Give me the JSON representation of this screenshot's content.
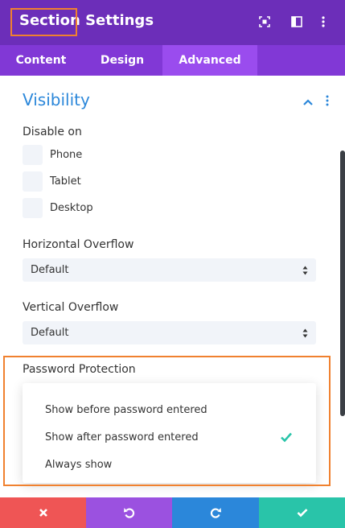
{
  "header": {
    "title": "Section Settings",
    "icons": [
      "screenshot-icon",
      "split-view-icon",
      "more-vertical-icon"
    ],
    "background_color": "#6c2eb9"
  },
  "tabs": [
    {
      "label": "Content",
      "active": false
    },
    {
      "label": "Design",
      "active": false
    },
    {
      "label": "Advanced",
      "active": true
    }
  ],
  "visibility": {
    "title": "Visibility",
    "disable_on": {
      "label": "Disable on",
      "options": [
        {
          "label": "Phone",
          "checked": false
        },
        {
          "label": "Tablet",
          "checked": false
        },
        {
          "label": "Desktop",
          "checked": false
        }
      ]
    },
    "horizontal_overflow": {
      "label": "Horizontal Overflow",
      "value": "Default"
    },
    "vertical_overflow": {
      "label": "Vertical Overflow",
      "value": "Default"
    },
    "password_protection": {
      "label": "Password Protection",
      "options": [
        {
          "label": "Show before password entered",
          "selected": false
        },
        {
          "label": "Show after password entered",
          "selected": true
        },
        {
          "label": "Always show",
          "selected": false
        }
      ]
    }
  },
  "footer": {
    "buttons": [
      {
        "name": "discard",
        "icon": "close-icon",
        "color": "#ef5555"
      },
      {
        "name": "undo",
        "icon": "undo-icon",
        "color": "#9b51e0"
      },
      {
        "name": "redo",
        "icon": "redo-icon",
        "color": "#2b87da"
      },
      {
        "name": "save",
        "icon": "check-icon",
        "color": "#29c4a9"
      }
    ]
  },
  "colors": {
    "accent_blue": "#2b87da",
    "check_teal": "#29c4a9",
    "highlight_orange": "#f0812f"
  }
}
